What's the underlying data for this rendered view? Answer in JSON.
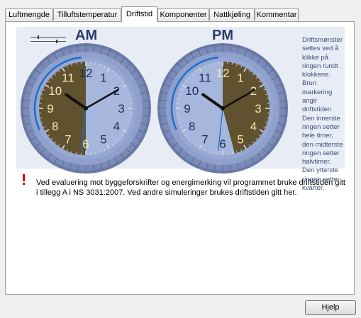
{
  "tabs": [
    {
      "label": "Luftmengde",
      "active": false
    },
    {
      "label": "Tilluftstemperatur",
      "active": false
    },
    {
      "label": "Driftstid",
      "active": true
    },
    {
      "label": "Komponenter",
      "active": false
    },
    {
      "label": "Nattkjøling",
      "active": false
    },
    {
      "label": "Kommentar",
      "active": false
    }
  ],
  "clocks": {
    "am": {
      "label": "AM",
      "numbers": [
        "12",
        "1",
        "2",
        "3",
        "4",
        "5",
        "6",
        "7",
        "8",
        "9",
        "10",
        "11"
      ],
      "operating_hours_start": 6,
      "operating_hours_end": 12,
      "time": {
        "hour": 10,
        "minute": 10,
        "second": 31
      }
    },
    "pm": {
      "label": "PM",
      "numbers": [
        "12",
        "1",
        "2",
        "3",
        "4",
        "5",
        "6",
        "7",
        "8",
        "9",
        "10",
        "11"
      ],
      "operating_hours_start": 0,
      "operating_hours_end": 5.5,
      "time": {
        "hour": 10,
        "minute": 10,
        "second": 31
      }
    }
  },
  "description": "Driftsmønster settes ved å klikke på ringen rundt klokkene. Brun markering angir driftstiden Den innerste ringen setter hele timer, den midterste ringen setter halvtimer. Den ytterste ringen setter kvarter.",
  "warning": {
    "icon": "exclamation-icon",
    "text": "Ved evaluering mot byggeforskrifter og energimerking vil programmet bruke driftstiden gitt i tillegg A i NS 3031:2007. Ved andre simuleringer brukes driftstiden gitt her."
  },
  "buttons": {
    "help_label": "Hjelp"
  },
  "colors": {
    "operating": "#5a4a1e",
    "dial_outer": "#7a8bb8",
    "dial_inner": "#a7b6dc",
    "numeral_light": "#f5e9b0",
    "numeral_dark": "#1c2a5a",
    "second_hand": "#1a6fd0"
  }
}
